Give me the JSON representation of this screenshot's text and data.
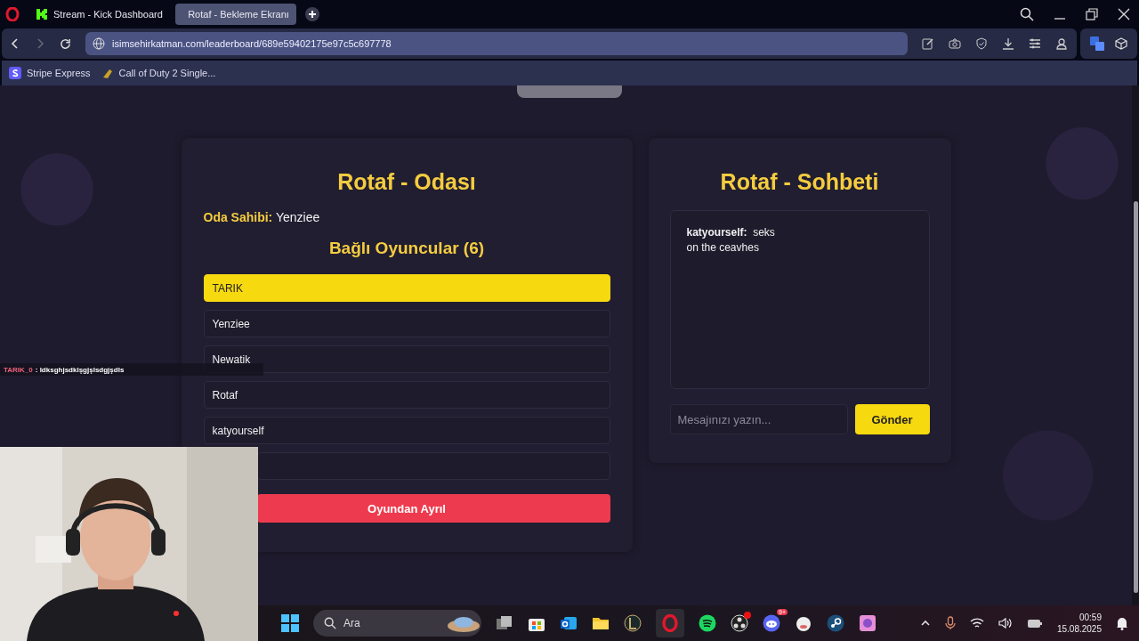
{
  "browser": {
    "tabs": [
      {
        "title": "Stream - Kick Dashboard",
        "selected": false,
        "kind": "kick"
      },
      {
        "title": "Rotaf - Bekleme Ekranı",
        "selected": true,
        "kind": "site"
      }
    ],
    "url": "isimsehirkatman.com/leaderboard/689e59402175e97c5c697778",
    "bookmarks": [
      {
        "label": "Stripe Express",
        "kind": "stripe"
      },
      {
        "label": "Call of Duty 2 Single...",
        "kind": "cod"
      }
    ]
  },
  "room": {
    "title": "Rotaf - Odası",
    "owner_label": "Oda Sahibi:",
    "owner": "Yenziee",
    "players_heading": "Bağlı Oyuncular (6)",
    "players": [
      {
        "name": "TARIK",
        "selected": true
      },
      {
        "name": "Yenziee",
        "selected": false
      },
      {
        "name": "Newatik",
        "selected": false
      },
      {
        "name": "Rotaf",
        "selected": false
      },
      {
        "name": "katyourself",
        "selected": false
      },
      {
        "kind": "covered",
        "selected": false
      }
    ],
    "leave_button": "Oyundan Ayrıl"
  },
  "chat": {
    "title": "Rotaf - Sohbeti",
    "messages": [
      {
        "user": "katyourself:",
        "text": "seks on the ceavhes"
      }
    ],
    "input": {
      "placeholder": "Mesajınızı yazın..."
    },
    "send_button": "Gönder"
  },
  "stream_chat_overlay": {
    "user": "TARIK_0",
    "separator": ":",
    "text": "ldksghjsdklşgjşlsdgjşdls"
  },
  "taskbar": {
    "search_placeholder": "Ara",
    "time": "00:59",
    "date": "15.08.2025",
    "discord_badge": "9+"
  }
}
